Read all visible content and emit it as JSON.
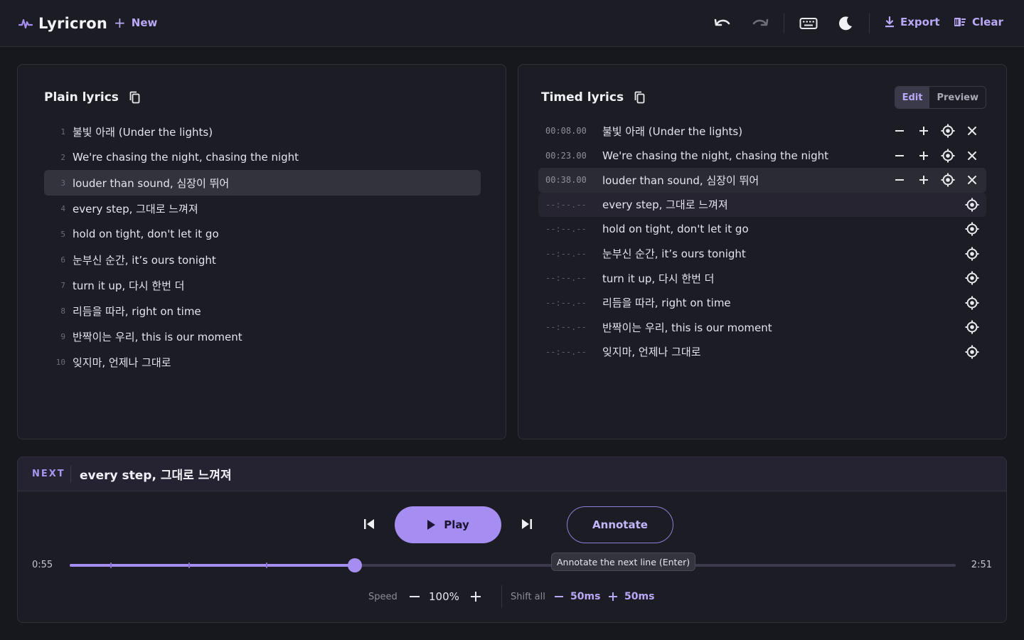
{
  "app": {
    "name": "Lyricron",
    "new_label": "New",
    "export_label": "Export",
    "clear_label": "Clear",
    "accent": "#a58df2"
  },
  "plain": {
    "title": "Plain lyrics",
    "lines": [
      {
        "num": "1",
        "text": "불빛 아래 (Under the lights)"
      },
      {
        "num": "2",
        "text": "We're chasing the night, chasing the night"
      },
      {
        "num": "3",
        "text": "louder than sound, 심장이 뛰어"
      },
      {
        "num": "4",
        "text": "every step, 그대로 느껴져"
      },
      {
        "num": "5",
        "text": "hold on tight, don't let it go"
      },
      {
        "num": "6",
        "text": "눈부신 순간, it’s ours tonight"
      },
      {
        "num": "7",
        "text": "turn it up, 다시 한번 더"
      },
      {
        "num": "8",
        "text": "리듬을 따라, right on time"
      },
      {
        "num": "9",
        "text": "반짝이는 우리, this is our moment"
      },
      {
        "num": "10",
        "text": "잊지마, 언제나 그대로"
      }
    ]
  },
  "timed": {
    "title": "Timed lyrics",
    "edit_label": "Edit",
    "preview_label": "Preview",
    "lines": [
      {
        "time": "00:08.00",
        "text": "불빛 아래 (Under the lights)"
      },
      {
        "time": "00:23.00",
        "text": "We're chasing the night, chasing the night"
      },
      {
        "time": "00:38.00",
        "text": "louder than sound, 심장이 뛰어"
      },
      {
        "time": "--:--.--",
        "text": "every step, 그대로 느껴져"
      },
      {
        "time": "--:--.--",
        "text": "hold on tight, don't let it go"
      },
      {
        "time": "--:--.--",
        "text": "눈부신 순간, it’s ours tonight"
      },
      {
        "time": "--:--.--",
        "text": "turn it up, 다시 한번 더"
      },
      {
        "time": "--:--.--",
        "text": "리듬을 따라, right on time"
      },
      {
        "time": "--:--.--",
        "text": "반짝이는 우리, this is our moment"
      },
      {
        "time": "--:--.--",
        "text": "잊지마, 언제나 그대로"
      }
    ]
  },
  "player": {
    "next_label": "NEXT",
    "next_text": "every step, 그대로 느껴져",
    "play_label": "Play",
    "annotate_label": "Annotate",
    "tooltip": "Annotate the next line (Enter)",
    "current_time": "0:55",
    "total_time": "2:51",
    "progress": 0.3216,
    "marker_fractions": [
      0.0468,
      0.1345,
      0.2222
    ],
    "speed_label": "Speed",
    "speed_value": "100%",
    "shift_label": "Shift all",
    "shift_minus": "50ms",
    "shift_plus": "50ms"
  }
}
